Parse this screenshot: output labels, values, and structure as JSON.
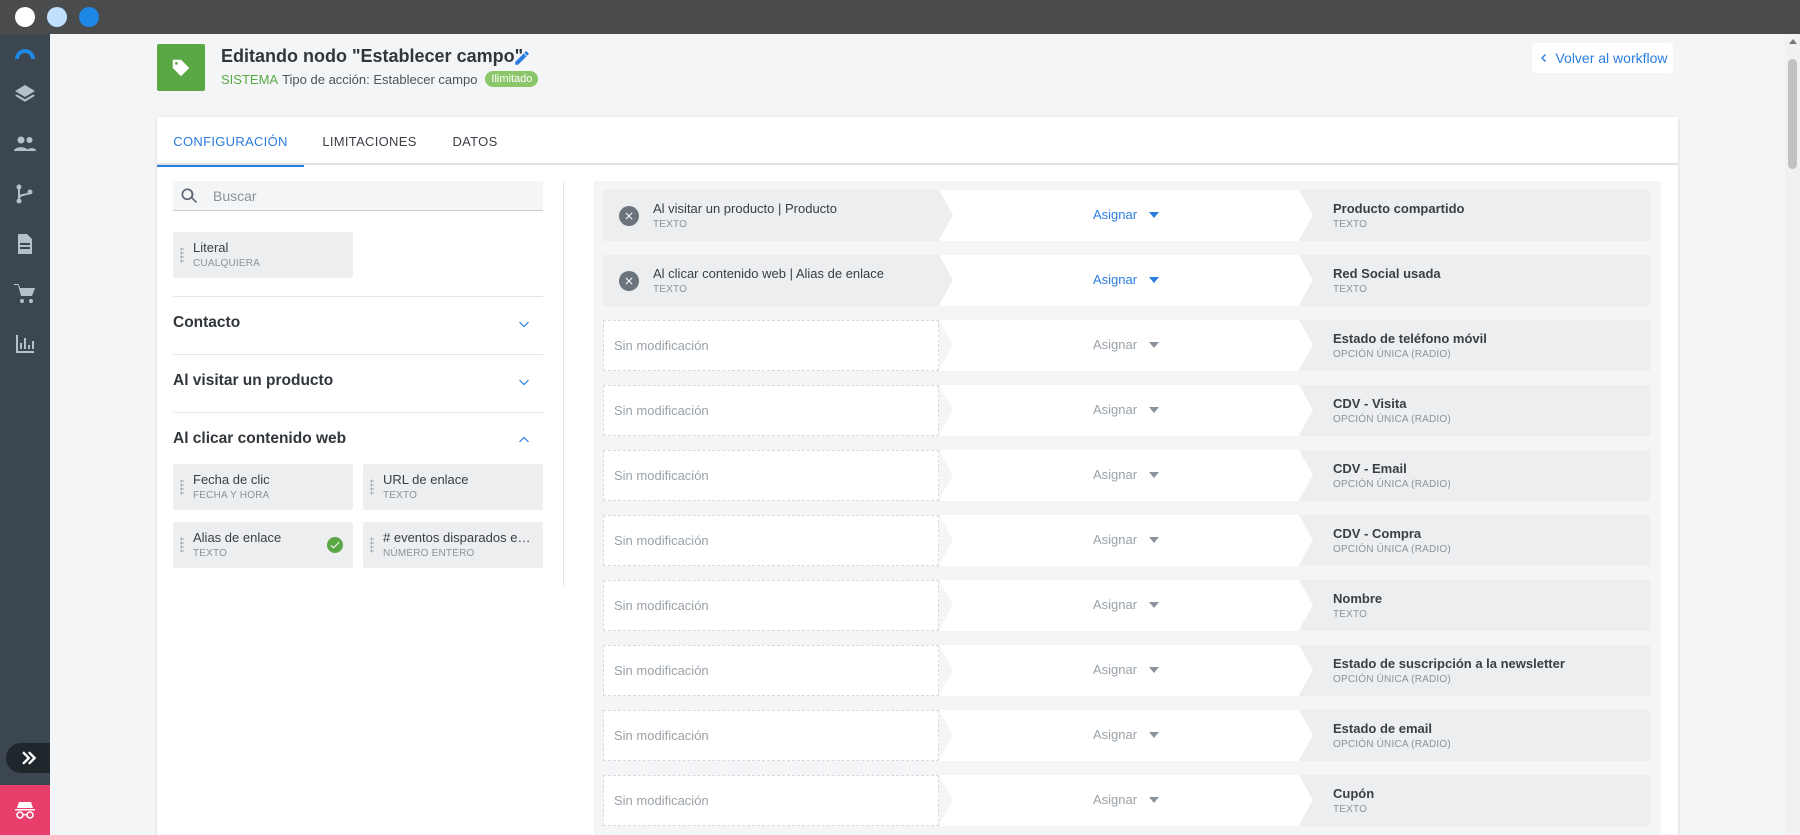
{
  "header": {
    "title": "Editando nodo \"Establecer campo\"",
    "system_label": "SISTEMA",
    "action_type": "Tipo de acción: Establecer campo",
    "badge": "Ilimitado",
    "back_label": "Volver al workflow"
  },
  "tabs": [
    {
      "label": "CONFIGURACIÓN",
      "active": true
    },
    {
      "label": "LIMITACIONES",
      "active": false
    },
    {
      "label": "DATOS",
      "active": false
    }
  ],
  "search": {
    "placeholder": "Buscar",
    "value": ""
  },
  "literal_chip": {
    "label": "Literal",
    "type": "CUALQUIERA"
  },
  "sections": [
    {
      "title": "Contacto",
      "expanded": false
    },
    {
      "title": "Al visitar un producto",
      "expanded": false
    },
    {
      "title": "Al clicar contenido web",
      "expanded": true
    }
  ],
  "web_fields": [
    {
      "label": "Fecha de clic",
      "type": "FECHA Y HORA",
      "used": false
    },
    {
      "label": "URL de enlace",
      "type": "TEXTO",
      "used": false
    },
    {
      "label": "Alias de enlace",
      "type": "TEXTO",
      "used": true
    },
    {
      "label": "# eventos disparados en el embudo",
      "type": "NÚMERO ENTERO",
      "used": false
    }
  ],
  "mappings": [
    {
      "source": "Al visitar un producto | Producto",
      "source_type": "TEXTO",
      "assign": "Asignar",
      "target": "Producto compartido",
      "target_type": "TEXTO",
      "assigned": true
    },
    {
      "source": "Al clicar contenido web | Alias de enlace",
      "source_type": "TEXTO",
      "assign": "Asignar",
      "target": "Red Social usada",
      "target_type": "TEXTO",
      "assigned": true
    },
    {
      "source": "Sin modificación",
      "source_type": "",
      "assign": "Asignar",
      "target": "Estado de teléfono móvil",
      "target_type": "OPCIÓN ÚNICA (RADIO)",
      "assigned": false
    },
    {
      "source": "Sin modificación",
      "source_type": "",
      "assign": "Asignar",
      "target": "CDV - Visita",
      "target_type": "OPCIÓN ÚNICA (RADIO)",
      "assigned": false
    },
    {
      "source": "Sin modificación",
      "source_type": "",
      "assign": "Asignar",
      "target": "CDV - Email",
      "target_type": "OPCIÓN ÚNICA (RADIO)",
      "assigned": false
    },
    {
      "source": "Sin modificación",
      "source_type": "",
      "assign": "Asignar",
      "target": "CDV - Compra",
      "target_type": "OPCIÓN ÚNICA (RADIO)",
      "assigned": false
    },
    {
      "source": "Sin modificación",
      "source_type": "",
      "assign": "Asignar",
      "target": "Nombre",
      "target_type": "TEXTO",
      "assigned": false
    },
    {
      "source": "Sin modificación",
      "source_type": "",
      "assign": "Asignar",
      "target": "Estado de suscripción a la newsletter",
      "target_type": "OPCIÓN ÚNICA (RADIO)",
      "assigned": false
    },
    {
      "source": "Sin modificación",
      "source_type": "",
      "assign": "Asignar",
      "target": "Estado de email",
      "target_type": "OPCIÓN ÚNICA (RADIO)",
      "assigned": false
    },
    {
      "source": "Sin modificación",
      "source_type": "",
      "assign": "Asignar",
      "target": "Cupón",
      "target_type": "TEXTO",
      "assigned": false
    }
  ],
  "colors": {
    "accent": "#2b7de0",
    "success": "#5aa845",
    "sidebar": "#3b4650",
    "user": "#e83e6c"
  },
  "icons": {
    "sidebar": [
      "logo-icon",
      "layers-icon",
      "people-icon",
      "workflow-icon",
      "document-icon",
      "cart-icon",
      "chart-icon"
    ],
    "header": "tag-icon"
  }
}
